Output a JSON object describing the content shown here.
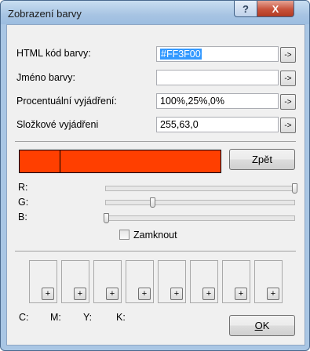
{
  "window": {
    "title": "Zobrazení barvy",
    "help_glyph": "?",
    "close_glyph": "X"
  },
  "rows": [
    {
      "label": "HTML kód barvy:",
      "value": "#FF3F00",
      "selected": true,
      "button": "->"
    },
    {
      "label": "Jméno barvy:",
      "value": "",
      "selected": false,
      "button": "->"
    },
    {
      "label": "Procentuální vyjádření:",
      "value": "100%,25%,0%",
      "selected": false,
      "button": "->"
    },
    {
      "label": "Složkové vyjádřeni",
      "value": "255,63,0",
      "selected": false,
      "button": "->"
    }
  ],
  "preview": {
    "current_color": "#FF3F00"
  },
  "back_button": "Zpět",
  "sliders": [
    {
      "label": "R:",
      "value": 255,
      "max": 255
    },
    {
      "label": "G:",
      "value": 63,
      "max": 255
    },
    {
      "label": "B:",
      "value": 0,
      "max": 255
    }
  ],
  "lock": {
    "label": "Zamknout",
    "checked": false
  },
  "palette": {
    "add_glyph": "+",
    "slot_count": 8
  },
  "cmyk": {
    "c": "C:",
    "m": "M:",
    "y": "Y:",
    "k": "K:"
  },
  "ok_button": {
    "label": "OK",
    "mnemonic": "O",
    "rest": "K"
  }
}
